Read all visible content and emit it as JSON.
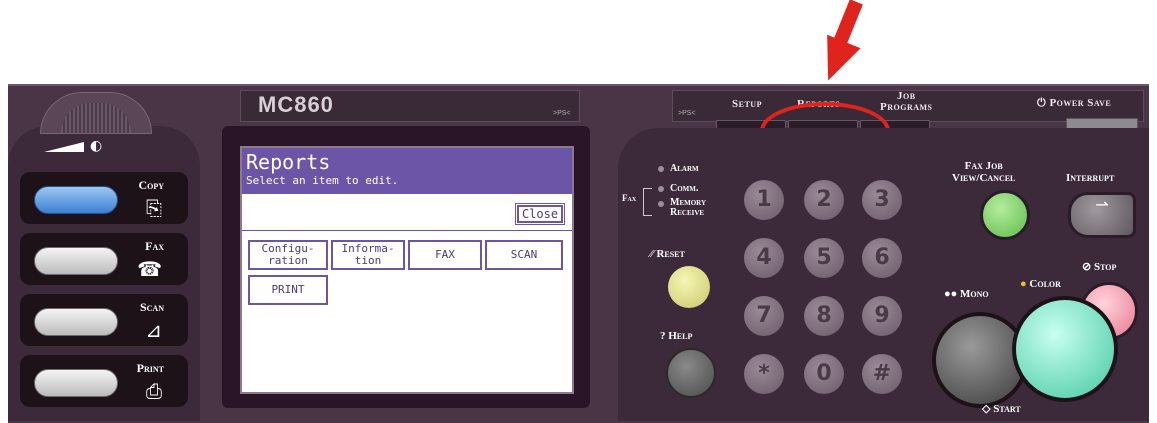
{
  "model": {
    "name": "MC860",
    "badge_left": ">PS<",
    "badge_right": ">PS<"
  },
  "top_menu": {
    "setup": "Setup",
    "reports": "Reports",
    "job_programs": "Job\nPrograms",
    "power_save": "Power Save"
  },
  "mode_buttons": [
    {
      "label": "Copy",
      "icon": "⎘"
    },
    {
      "label": "Fax",
      "icon": "☎"
    },
    {
      "label": "Scan",
      "icon": "⊿"
    },
    {
      "label": "Print",
      "icon": "⎙"
    }
  ],
  "screen": {
    "title": "Reports",
    "subtitle": "Select an item to edit.",
    "close_label": "Close",
    "options": [
      "Configu-\nration",
      "Informa-\ntion",
      "FAX",
      "SCAN",
      "PRINT"
    ]
  },
  "indicators": {
    "alarm": "Alarm",
    "comm": "Comm.",
    "memory_receive": "Memory\nReceive",
    "fax": "Fax"
  },
  "control": {
    "reset": "Reset",
    "help": "Help",
    "fax_job": "Fax Job\nView/Cancel",
    "interrupt": "Interrupt",
    "stop": "Stop",
    "mono": "Mono",
    "color": "Color",
    "start": "Start"
  },
  "keypad": [
    "1",
    "2",
    "3",
    "4",
    "5",
    "6",
    "7",
    "8",
    "9",
    "*",
    "0",
    "#"
  ],
  "colors": {
    "panel": "#4a3547",
    "screen_accent": "#6c55a6",
    "highlight": "#e0241c"
  }
}
